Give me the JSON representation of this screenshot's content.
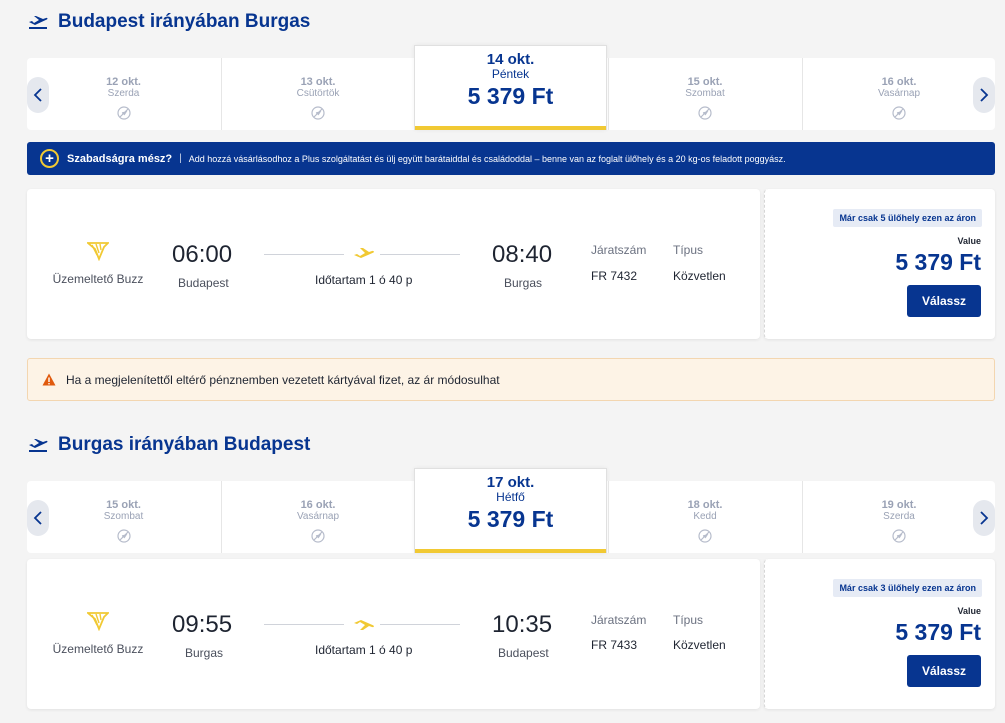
{
  "outbound": {
    "title": "Budapest irányában Burgas",
    "dates": [
      {
        "date": "12 okt.",
        "weekday": "Szerda"
      },
      {
        "date": "13 okt.",
        "weekday": "Csütörtök"
      },
      {
        "date": "14 okt.",
        "weekday": "Péntek",
        "price": "5 379 Ft",
        "selected": true
      },
      {
        "date": "15 okt.",
        "weekday": "Szombat"
      },
      {
        "date": "16 okt.",
        "weekday": "Vasárnap"
      }
    ],
    "flight": {
      "operator": "Üzemeltető Buzz",
      "dep_time": "06:00",
      "dep_city": "Budapest",
      "duration": "Időtartam 1 ó 40 p",
      "arr_time": "08:40",
      "arr_city": "Burgas",
      "flight_no_label": "Járatszám",
      "flight_no": "FR 7432",
      "type_label": "Típus",
      "type": "Közvetlen",
      "seats_badge": "Már csak 5 ülőhely ezen az áron",
      "value_label": "Value",
      "price": "5 379 Ft",
      "select_label": "Válassz"
    }
  },
  "promo": {
    "title": "Szabadságra mész?",
    "divider": "|",
    "text": "Add hozzá vásárlásodhoz a Plus szolgáltatást és ülj együtt barátaiddal és családoddal – benne van az foglalt ülőhely és a 20 kg-os feladott poggyász."
  },
  "warning": {
    "text": "Ha a megjelenítettől eltérő pénznemben vezetett kártyával fizet, az ár módosulhat"
  },
  "inbound": {
    "title": "Burgas irányában Budapest",
    "dates": [
      {
        "date": "15 okt.",
        "weekday": "Szombat"
      },
      {
        "date": "16 okt.",
        "weekday": "Vasárnap"
      },
      {
        "date": "17 okt.",
        "weekday": "Hétfő",
        "price": "5 379 Ft",
        "selected": true
      },
      {
        "date": "18 okt.",
        "weekday": "Kedd"
      },
      {
        "date": "19 okt.",
        "weekday": "Szerda"
      }
    ],
    "flight": {
      "operator": "Üzemeltető Buzz",
      "dep_time": "09:55",
      "dep_city": "Burgas",
      "duration": "Időtartam 1 ó 40 p",
      "arr_time": "10:35",
      "arr_city": "Budapest",
      "flight_no_label": "Járatszám",
      "flight_no": "FR 7433",
      "type_label": "Típus",
      "type": "Közvetlen",
      "seats_badge": "Már csak 3 ülőhely ezen az áron",
      "value_label": "Value",
      "price": "5 379 Ft",
      "select_label": "Válassz"
    }
  },
  "colors": {
    "brand": "#073590",
    "accent": "#f1c933",
    "warning": "#e05a0e"
  }
}
